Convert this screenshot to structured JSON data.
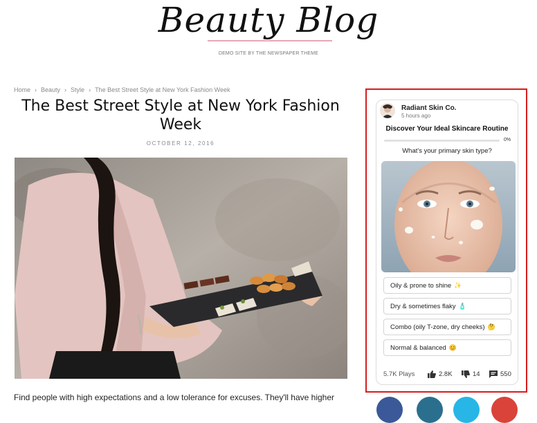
{
  "site": {
    "logo_text": "Beauty Blog",
    "tagline": "DEMO SITE BY THE NEWSPAPER THEME"
  },
  "breadcrumb": {
    "items": [
      "Home",
      "Beauty",
      "Style",
      "The Best Street Style at New York Fashion Week"
    ],
    "separator": "›"
  },
  "post": {
    "title": "The Best Street Style at New York Fashion Week",
    "date": "OCTOBER 12, 2016",
    "body_start": "Find people with high expectations and a low tolerance for excuses. They'll have higher"
  },
  "quiz": {
    "brand": "Radiant Skin Co.",
    "time_ago": "5 hours ago",
    "title": "Discover Your Ideal Skincare Routine",
    "progress_label": "0%",
    "progress_fraction": 0,
    "question": "What's your primary skin type?",
    "options": [
      {
        "label": "Oily & prone to shine",
        "emoji": "✨"
      },
      {
        "label": "Dry & sometimes flaky",
        "emoji": "🧴"
      },
      {
        "label": "Combo (oily T-zone, dry cheeks)",
        "emoji": "🤔"
      },
      {
        "label": "Normal & balanced",
        "emoji": "😊"
      }
    ],
    "stats": {
      "plays": "5.7K Plays",
      "likes": "2.8K",
      "dislikes": "14",
      "comments": "550"
    }
  },
  "colors": {
    "ad_border": "#d51d1d",
    "logo_underline": "#e8a6b5"
  }
}
